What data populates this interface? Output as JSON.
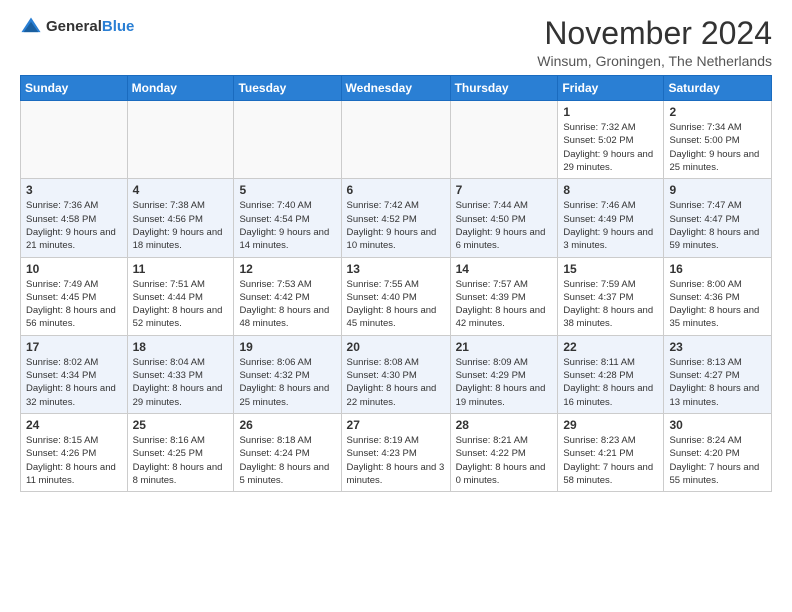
{
  "header": {
    "logo_general": "General",
    "logo_blue": "Blue",
    "title": "November 2024",
    "location": "Winsum, Groningen, The Netherlands"
  },
  "calendar": {
    "columns": [
      "Sunday",
      "Monday",
      "Tuesday",
      "Wednesday",
      "Thursday",
      "Friday",
      "Saturday"
    ],
    "weeks": [
      [
        {
          "day": "",
          "content": ""
        },
        {
          "day": "",
          "content": ""
        },
        {
          "day": "",
          "content": ""
        },
        {
          "day": "",
          "content": ""
        },
        {
          "day": "",
          "content": ""
        },
        {
          "day": "1",
          "content": "Sunrise: 7:32 AM\nSunset: 5:02 PM\nDaylight: 9 hours and 29 minutes."
        },
        {
          "day": "2",
          "content": "Sunrise: 7:34 AM\nSunset: 5:00 PM\nDaylight: 9 hours and 25 minutes."
        }
      ],
      [
        {
          "day": "3",
          "content": "Sunrise: 7:36 AM\nSunset: 4:58 PM\nDaylight: 9 hours and 21 minutes."
        },
        {
          "day": "4",
          "content": "Sunrise: 7:38 AM\nSunset: 4:56 PM\nDaylight: 9 hours and 18 minutes."
        },
        {
          "day": "5",
          "content": "Sunrise: 7:40 AM\nSunset: 4:54 PM\nDaylight: 9 hours and 14 minutes."
        },
        {
          "day": "6",
          "content": "Sunrise: 7:42 AM\nSunset: 4:52 PM\nDaylight: 9 hours and 10 minutes."
        },
        {
          "day": "7",
          "content": "Sunrise: 7:44 AM\nSunset: 4:50 PM\nDaylight: 9 hours and 6 minutes."
        },
        {
          "day": "8",
          "content": "Sunrise: 7:46 AM\nSunset: 4:49 PM\nDaylight: 9 hours and 3 minutes."
        },
        {
          "day": "9",
          "content": "Sunrise: 7:47 AM\nSunset: 4:47 PM\nDaylight: 8 hours and 59 minutes."
        }
      ],
      [
        {
          "day": "10",
          "content": "Sunrise: 7:49 AM\nSunset: 4:45 PM\nDaylight: 8 hours and 56 minutes."
        },
        {
          "day": "11",
          "content": "Sunrise: 7:51 AM\nSunset: 4:44 PM\nDaylight: 8 hours and 52 minutes."
        },
        {
          "day": "12",
          "content": "Sunrise: 7:53 AM\nSunset: 4:42 PM\nDaylight: 8 hours and 48 minutes."
        },
        {
          "day": "13",
          "content": "Sunrise: 7:55 AM\nSunset: 4:40 PM\nDaylight: 8 hours and 45 minutes."
        },
        {
          "day": "14",
          "content": "Sunrise: 7:57 AM\nSunset: 4:39 PM\nDaylight: 8 hours and 42 minutes."
        },
        {
          "day": "15",
          "content": "Sunrise: 7:59 AM\nSunset: 4:37 PM\nDaylight: 8 hours and 38 minutes."
        },
        {
          "day": "16",
          "content": "Sunrise: 8:00 AM\nSunset: 4:36 PM\nDaylight: 8 hours and 35 minutes."
        }
      ],
      [
        {
          "day": "17",
          "content": "Sunrise: 8:02 AM\nSunset: 4:34 PM\nDaylight: 8 hours and 32 minutes."
        },
        {
          "day": "18",
          "content": "Sunrise: 8:04 AM\nSunset: 4:33 PM\nDaylight: 8 hours and 29 minutes."
        },
        {
          "day": "19",
          "content": "Sunrise: 8:06 AM\nSunset: 4:32 PM\nDaylight: 8 hours and 25 minutes."
        },
        {
          "day": "20",
          "content": "Sunrise: 8:08 AM\nSunset: 4:30 PM\nDaylight: 8 hours and 22 minutes."
        },
        {
          "day": "21",
          "content": "Sunrise: 8:09 AM\nSunset: 4:29 PM\nDaylight: 8 hours and 19 minutes."
        },
        {
          "day": "22",
          "content": "Sunrise: 8:11 AM\nSunset: 4:28 PM\nDaylight: 8 hours and 16 minutes."
        },
        {
          "day": "23",
          "content": "Sunrise: 8:13 AM\nSunset: 4:27 PM\nDaylight: 8 hours and 13 minutes."
        }
      ],
      [
        {
          "day": "24",
          "content": "Sunrise: 8:15 AM\nSunset: 4:26 PM\nDaylight: 8 hours and 11 minutes."
        },
        {
          "day": "25",
          "content": "Sunrise: 8:16 AM\nSunset: 4:25 PM\nDaylight: 8 hours and 8 minutes."
        },
        {
          "day": "26",
          "content": "Sunrise: 8:18 AM\nSunset: 4:24 PM\nDaylight: 8 hours and 5 minutes."
        },
        {
          "day": "27",
          "content": "Sunrise: 8:19 AM\nSunset: 4:23 PM\nDaylight: 8 hours and 3 minutes."
        },
        {
          "day": "28",
          "content": "Sunrise: 8:21 AM\nSunset: 4:22 PM\nDaylight: 8 hours and 0 minutes."
        },
        {
          "day": "29",
          "content": "Sunrise: 8:23 AM\nSunset: 4:21 PM\nDaylight: 7 hours and 58 minutes."
        },
        {
          "day": "30",
          "content": "Sunrise: 8:24 AM\nSunset: 4:20 PM\nDaylight: 7 hours and 55 minutes."
        }
      ]
    ]
  }
}
